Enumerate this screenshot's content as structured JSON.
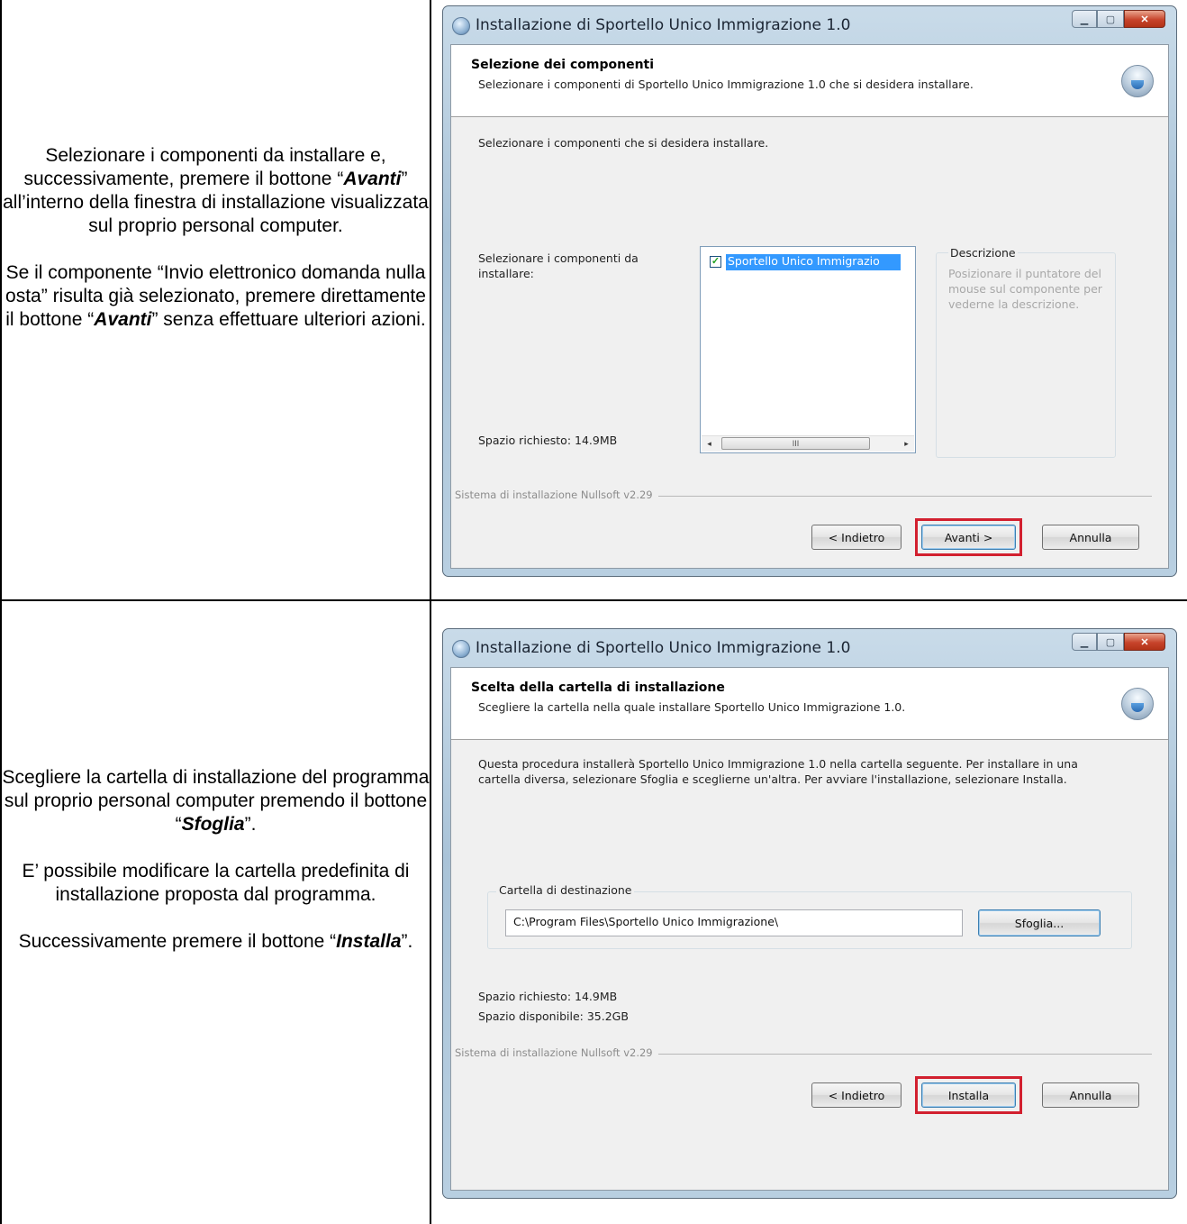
{
  "row1": {
    "instructions": {
      "p1_a": "Selezionare i componenti da installare e, successivamente, premere il bottone “",
      "p1_bold": "Avanti",
      "p1_c": "” all’interno della finestra di installazione visualizzata sul proprio personal computer.",
      "p2_a": "Se il componente “Invio elettronico domanda nulla osta” risulta già selezionato, premere direttamente il bottone “",
      "p2_bold": "Avanti",
      "p2_c": "” senza effettuare ulteriori azioni."
    },
    "window": {
      "title": "Installazione di Sportello Unico Immigrazione 1.0",
      "header_title": "Selezione dei componenti",
      "header_subtitle": "Selezionare i componenti di Sportello Unico Immigrazione 1.0 che si desidera installare.",
      "intro": "Selezionare i componenti che si desidera installare.",
      "select_label": "Selezionare i componenti da installare:",
      "component_item": "Sportello Unico Immigrazio",
      "component_checked": true,
      "description_title": "Descrizione",
      "description_text": "Posizionare il puntatore del mouse sul componente per vederne la descrizione.",
      "space_required": "Spazio richiesto: 14.9MB",
      "branding": "Sistema di installazione Nullsoft v2.29",
      "back_button": "< Indietro",
      "next_button": "Avanti >",
      "cancel_button": "Annulla",
      "scroll_thumb_grip": "III"
    }
  },
  "row2": {
    "instructions": {
      "p1_a": "Scegliere la cartella di installazione del programma sul proprio personal computer premendo il bottone “",
      "p1_bold": "Sfoglia",
      "p1_c": "”.",
      "p2": "E’ possibile modificare la cartella predefinita di installazione proposta dal programma.",
      "p3_a": "Successivamente premere il bottone “",
      "p3_bold": "Installa",
      "p3_c": "”."
    },
    "window": {
      "title": "Installazione di Sportello Unico Immigrazione 1.0",
      "header_title": "Scelta della cartella di installazione",
      "header_subtitle": "Scegliere la cartella nella quale installare Sportello Unico Immigrazione 1.0.",
      "intro": "Questa procedura installerà Sportello Unico Immigrazione 1.0 nella cartella seguente. Per installare in una cartella diversa, selezionare Sfoglia e sceglierne un'altra. Per avviare l'installazione, selezionare Installa.",
      "group_label": "Cartella di destinazione",
      "path_value": "C:\\Program Files\\Sportello Unico Immigrazione\\",
      "browse_button": "Sfoglia...",
      "space_required": "Spazio richiesto: 14.9MB",
      "space_available": "Spazio disponibile: 35.2GB",
      "branding": "Sistema di installazione Nullsoft v2.29",
      "back_button": "< Indietro",
      "install_button": "Installa",
      "cancel_button": "Annulla"
    }
  },
  "colors": {
    "highlight": "#d2202f",
    "selection": "#3399ff"
  },
  "icons": [
    "installer-app-icon",
    "setup-disc-icon",
    "minimize-icon",
    "maximize-icon",
    "close-icon",
    "checkmark-icon",
    "scroll-left-arrow-icon",
    "scroll-right-arrow-icon"
  ]
}
